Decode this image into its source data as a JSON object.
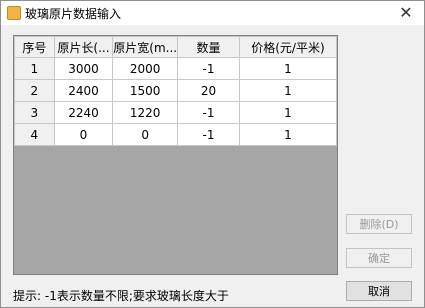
{
  "window": {
    "title": "玻璃原片数据输入"
  },
  "table": {
    "headers": [
      "序号",
      "原片长(...",
      "原片宽(m...",
      "数量",
      "价格(元/平米)"
    ],
    "rows": [
      [
        "1",
        "3000",
        "2000",
        "-1",
        "1"
      ],
      [
        "2",
        "2400",
        "1500",
        "20",
        "1"
      ],
      [
        "3",
        "2240",
        "1220",
        "-1",
        "1"
      ],
      [
        "4",
        "0",
        "0",
        "-1",
        "1"
      ]
    ]
  },
  "buttons": {
    "delete": "删除(D)",
    "confirm": "确定",
    "cancel": "取消"
  },
  "hint": "提示: -1表示数量不限;要求玻璃长度大于"
}
